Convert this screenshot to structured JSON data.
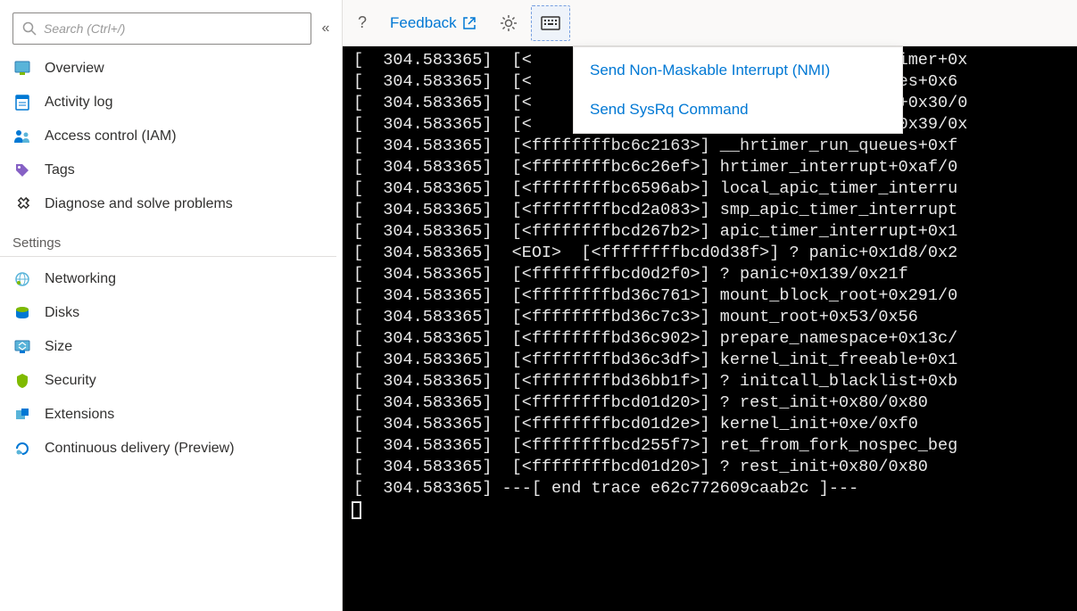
{
  "search": {
    "placeholder": "Search (Ctrl+/)"
  },
  "nav": {
    "main": [
      {
        "label": "Overview",
        "icon": "overview"
      },
      {
        "label": "Activity log",
        "icon": "activity-log"
      },
      {
        "label": "Access control (IAM)",
        "icon": "access-control"
      },
      {
        "label": "Tags",
        "icon": "tags"
      },
      {
        "label": "Diagnose and solve problems",
        "icon": "diagnose"
      }
    ],
    "settings_header": "Settings",
    "settings": [
      {
        "label": "Networking",
        "icon": "networking"
      },
      {
        "label": "Disks",
        "icon": "disks"
      },
      {
        "label": "Size",
        "icon": "size"
      },
      {
        "label": "Security",
        "icon": "security"
      },
      {
        "label": "Extensions",
        "icon": "extensions"
      },
      {
        "label": "Continuous delivery (Preview)",
        "icon": "continuous-delivery"
      }
    ]
  },
  "toolbar": {
    "feedback_label": "Feedback"
  },
  "dropdown": {
    "items": [
      "Send Non-Maskable Interrupt (NMI)",
      "Send SysRq Command"
    ]
  },
  "console_lines": [
    "[  304.583365]  [<                             hed_do_timer+0x",
    "[  304.583365]  [<                             cess_times+0x6",
    "[  304.583365]  [<                             d_handle+0x30/0",
    "[  304.583365]  [<                             d_timer+0x39/0x",
    "[  304.583365]  [<ffffffffbc6c2163>] __hrtimer_run_queues+0xf",
    "[  304.583365]  [<ffffffffbc6c26ef>] hrtimer_interrupt+0xaf/0",
    "[  304.583365]  [<ffffffffbc6596ab>] local_apic_timer_interru",
    "[  304.583365]  [<ffffffffbcd2a083>] smp_apic_timer_interrupt",
    "[  304.583365]  [<ffffffffbcd267b2>] apic_timer_interrupt+0x1",
    "[  304.583365]  <EOI>  [<ffffffffbcd0d38f>] ? panic+0x1d8/0x2",
    "[  304.583365]  [<ffffffffbcd0d2f0>] ? panic+0x139/0x21f",
    "[  304.583365]  [<ffffffffbd36c761>] mount_block_root+0x291/0",
    "[  304.583365]  [<ffffffffbd36c7c3>] mount_root+0x53/0x56",
    "[  304.583365]  [<ffffffffbd36c902>] prepare_namespace+0x13c/",
    "[  304.583365]  [<ffffffffbd36c3df>] kernel_init_freeable+0x1",
    "[  304.583365]  [<ffffffffbd36bb1f>] ? initcall_blacklist+0xb",
    "[  304.583365]  [<ffffffffbcd01d20>] ? rest_init+0x80/0x80",
    "[  304.583365]  [<ffffffffbcd01d2e>] kernel_init+0xe/0xf0",
    "[  304.583365]  [<ffffffffbcd255f7>] ret_from_fork_nospec_beg",
    "[  304.583365]  [<ffffffffbcd01d20>] ? rest_init+0x80/0x80",
    "[  304.583365] ---[ end trace e62c772609caab2c ]---"
  ]
}
